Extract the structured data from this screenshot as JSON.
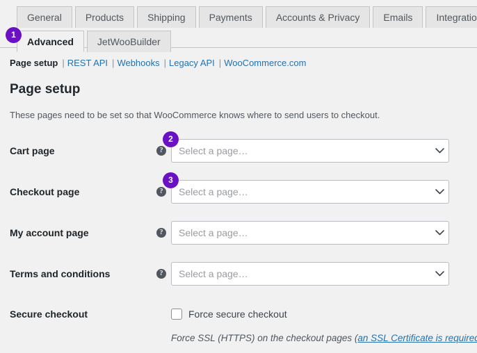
{
  "tabs": {
    "row1": [
      {
        "label": "General",
        "active": false
      },
      {
        "label": "Products",
        "active": false
      },
      {
        "label": "Shipping",
        "active": false
      },
      {
        "label": "Payments",
        "active": false
      },
      {
        "label": "Accounts & Privacy",
        "active": false
      },
      {
        "label": "Emails",
        "active": false
      },
      {
        "label": "Integration",
        "active": false
      }
    ],
    "row2": [
      {
        "label": "Advanced",
        "active": true
      },
      {
        "label": "JetWooBuilder",
        "active": false
      }
    ]
  },
  "badges": [
    {
      "id": 1,
      "label": "1",
      "target": "tab-advanced"
    },
    {
      "id": 2,
      "label": "2",
      "target": "cart-page-select"
    },
    {
      "id": 3,
      "label": "3",
      "target": "checkout-page-select"
    }
  ],
  "subnav": {
    "items": [
      {
        "label": "Page setup",
        "current": true
      },
      {
        "label": "REST API",
        "current": false
      },
      {
        "label": "Webhooks",
        "current": false
      },
      {
        "label": "Legacy API",
        "current": false
      },
      {
        "label": "WooCommerce.com",
        "current": false
      }
    ],
    "separator": "|"
  },
  "section": {
    "title": "Page setup",
    "description": "These pages need to be set so that WooCommerce knows where to send users to checkout."
  },
  "fields": [
    {
      "label": "Cart page",
      "help": "?",
      "placeholder": "Select a page…",
      "value": ""
    },
    {
      "label": "Checkout page",
      "help": "?",
      "placeholder": "Select a page…",
      "value": ""
    },
    {
      "label": "My account page",
      "help": "?",
      "placeholder": "Select a page…",
      "value": ""
    },
    {
      "label": "Terms and conditions",
      "help": "?",
      "placeholder": "Select a page…",
      "value": ""
    }
  ],
  "secure_checkout": {
    "label": "Secure checkout",
    "checkbox_label": "Force secure checkout",
    "checked": false,
    "hint_before": "Force SSL (HTTPS) on the checkout pages (",
    "hint_link": "an SSL Certificate is required",
    "hint_after": ")."
  },
  "colors": {
    "badge_purple": "#6b11c4",
    "link_blue": "#2271b1",
    "background": "#f1f1f1",
    "tab_inactive": "#e5e5e5",
    "border": "#c3c4c7"
  }
}
